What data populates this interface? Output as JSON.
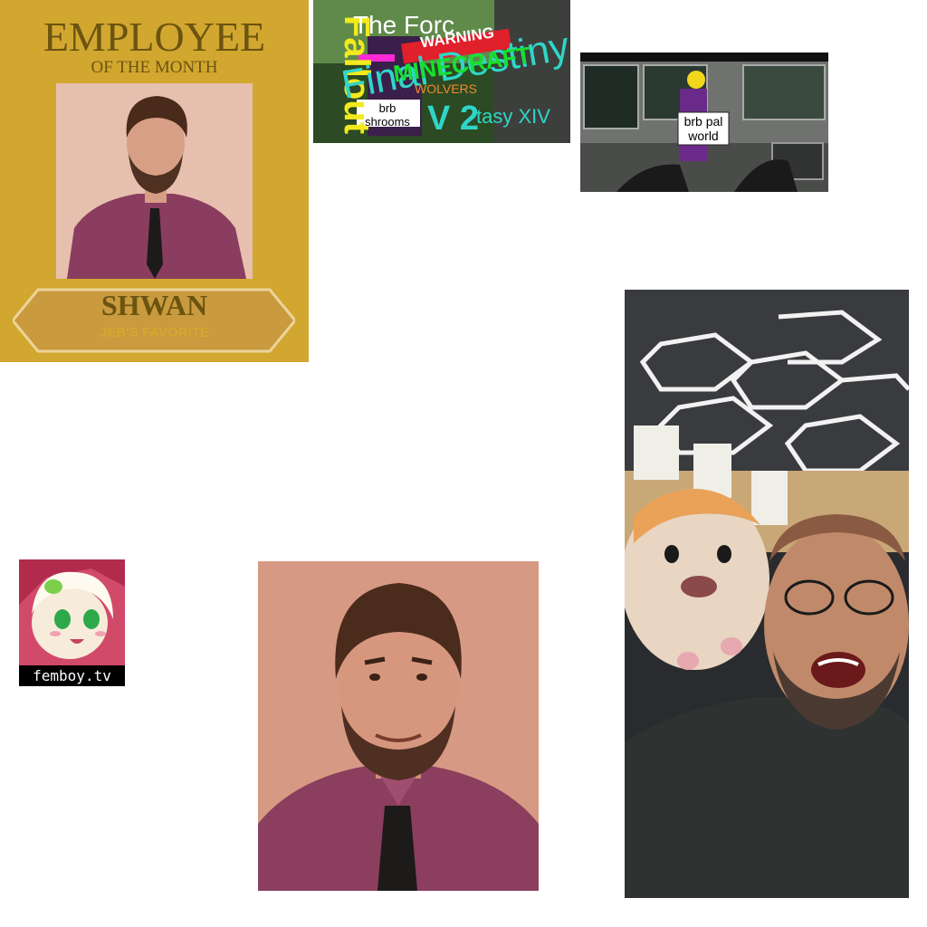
{
  "poster": {
    "title": "EMPLOYEE",
    "subtitle": "OF THE MONTH",
    "name": "SHWAN",
    "tagline": "JEB'S FAVORITE",
    "colors": {
      "background": "#d2a72f",
      "text": "#6b5410",
      "banner": "#c99a3e"
    }
  },
  "collage": {
    "texts": {
      "fallout": "Fallout",
      "the_force": "The Forc",
      "final_destiny": "Final Destiny",
      "warning": "WARNING",
      "minecraft": "MINECRAFT",
      "wolvers": "WOLVERS",
      "brb_shrooms": "brb shrooms",
      "v2": "V 2",
      "fantasy": "tasy XIV"
    }
  },
  "cockpit": {
    "sign": "brb pal world"
  },
  "femboy": {
    "label": "femboy.tv"
  }
}
